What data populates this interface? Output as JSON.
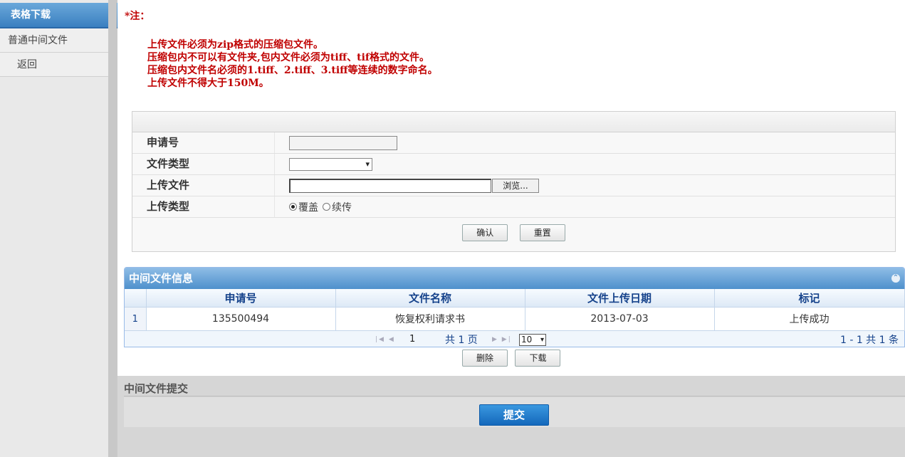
{
  "sidebar": {
    "header": "表格下载",
    "items": [
      {
        "label": "普通中间文件"
      },
      {
        "label": "返回"
      }
    ]
  },
  "notes": {
    "title": "*注：",
    "lines": [
      "上传文件必须为zip格式的压缩包文件。",
      "压缩包内不可以有文件夹,包内文件必须为tiff、tif格式的文件。",
      "压缩包内文件名必须的1.tiff、2.tiff、3.tiff等连续的数字命名。",
      "上传文件不得大于150M。"
    ]
  },
  "form": {
    "application_no_label": "申请号",
    "application_no_value": "",
    "file_type_label": "文件类型",
    "file_type_value": "",
    "upload_file_label": "上传文件",
    "browse_label": "浏览...",
    "upload_type_label": "上传类型",
    "upload_type_options": [
      "覆盖",
      "续传"
    ],
    "upload_type_selected": "覆盖",
    "confirm_label": "确认",
    "reset_label": "重置"
  },
  "grid": {
    "title": "中间文件信息",
    "columns": [
      "申请号",
      "文件名称",
      "文件上传日期",
      "标记"
    ],
    "rows": [
      {
        "index": "1",
        "cells": [
          "135500494",
          "恢复权利请求书",
          "2013-07-03",
          "上传成功"
        ]
      }
    ],
    "pager": {
      "page": "1",
      "total_pages_text": "共 1 页",
      "page_size": "10",
      "range_text": "1 - 1  共 1 条"
    },
    "delete_label": "删除",
    "download_label": "下载"
  },
  "submit_section": {
    "title": "中间文件提交",
    "submit_label": "提交"
  },
  "colors": {
    "accent_blue": "#3a7fc0",
    "note_red": "#c00000",
    "grid_header_text": "#15428b",
    "submit_blue": "#1468bb"
  }
}
